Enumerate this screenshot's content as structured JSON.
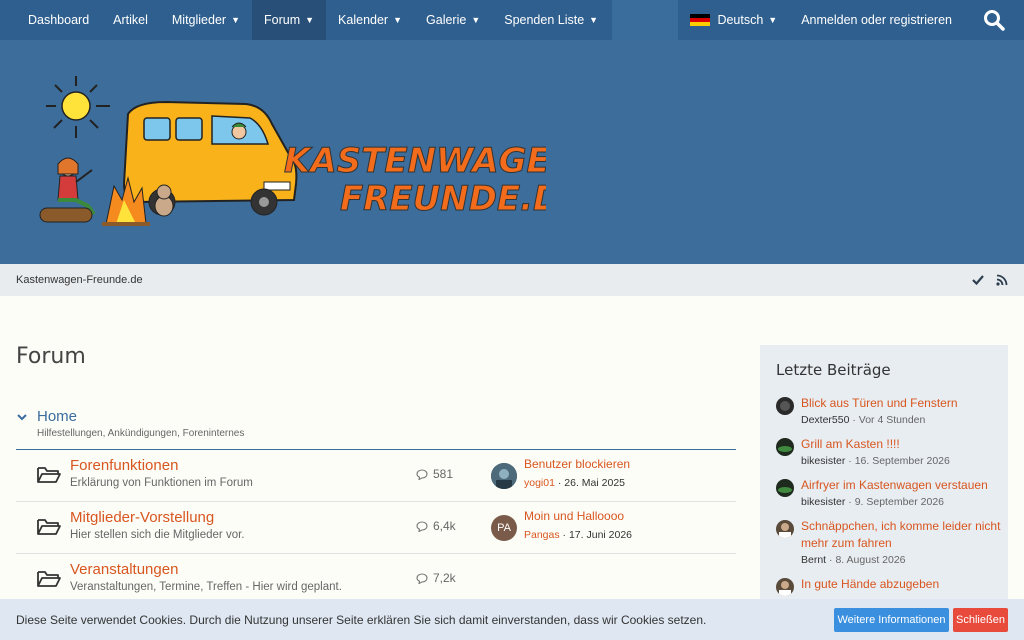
{
  "nav": {
    "items": [
      {
        "label": "Dashboard",
        "caret": false
      },
      {
        "label": "Artikel",
        "caret": false
      },
      {
        "label": "Mitglieder",
        "caret": true
      },
      {
        "label": "Forum",
        "caret": true,
        "active": true
      },
      {
        "label": "Kalender",
        "caret": true
      },
      {
        "label": "Galerie",
        "caret": true
      },
      {
        "label": "Spenden Liste",
        "caret": true
      }
    ],
    "language": "Deutsch",
    "login": "Anmelden oder registrieren",
    "search_icon": "search-icon"
  },
  "banner": {
    "logo_text_line1": "KASTENWAGEN-",
    "logo_text_line2": "FREUNDE.DE"
  },
  "breadcrumb": {
    "label": "Kastenwagen-Freunde.de",
    "icons": [
      "checkmark-icon",
      "rss-icon"
    ]
  },
  "main": {
    "title": "Forum",
    "category": {
      "title": "Home",
      "description": "Hilfestellungen, Ankündigungen, Foreninternes"
    },
    "forums": [
      {
        "title": "Forenfunktionen",
        "description": "Erklärung von Funktionen im Forum",
        "count": "581",
        "last_title": "Benutzer blockieren",
        "last_user": "yogi01",
        "last_date": "26. Mai 2025",
        "avatar_initials": ""
      },
      {
        "title": "Mitglieder-Vorstellung",
        "description": "Hier stellen sich die Mitglieder vor.",
        "count": "6,4k",
        "last_title": "Moin und Halloooo",
        "last_user": "Pangas",
        "last_date": "17. Juni 2026",
        "avatar_initials": "PA"
      },
      {
        "title": "Veranstaltungen",
        "description": "Veranstaltungen, Termine, Treffen - Hier wird geplant.",
        "count": "7,2k",
        "last_title": "",
        "last_user": "",
        "last_date": "",
        "avatar_initials": ""
      }
    ]
  },
  "sidebar": {
    "title": "Letzte Beiträge",
    "posts": [
      {
        "title": "Blick aus Türen und Fenstern",
        "user": "Dexter550",
        "date": "Vor 4 Stunden"
      },
      {
        "title": "Grill am Kasten !!!!",
        "user": "bikesister",
        "date": "16. September 2026"
      },
      {
        "title": "Airfryer im Kastenwagen verstauen",
        "user": "bikesister",
        "date": "9. September 2026"
      },
      {
        "title": "Schnäppchen, ich komme leider nicht mehr zum fahren",
        "user": "Bernt",
        "date": "8. August 2026"
      },
      {
        "title": "In gute Hände abzugeben",
        "user": "",
        "date": ""
      }
    ]
  },
  "cookie": {
    "text": "Diese Seite verwendet Cookies. Durch die Nutzung unserer Seite erklären Sie sich damit einverstanden, dass wir Cookies setzen.",
    "more_label": "Weitere Informationen",
    "close_label": "Schließen"
  },
  "colors": {
    "nav_bg": "#2f5f8e",
    "banner_bg": "#3d6d9b",
    "link_orange": "#d8561f",
    "accent_blue": "#3a6c9c",
    "btn_blue": "#3a8fdf",
    "btn_red": "#e84a3c"
  }
}
